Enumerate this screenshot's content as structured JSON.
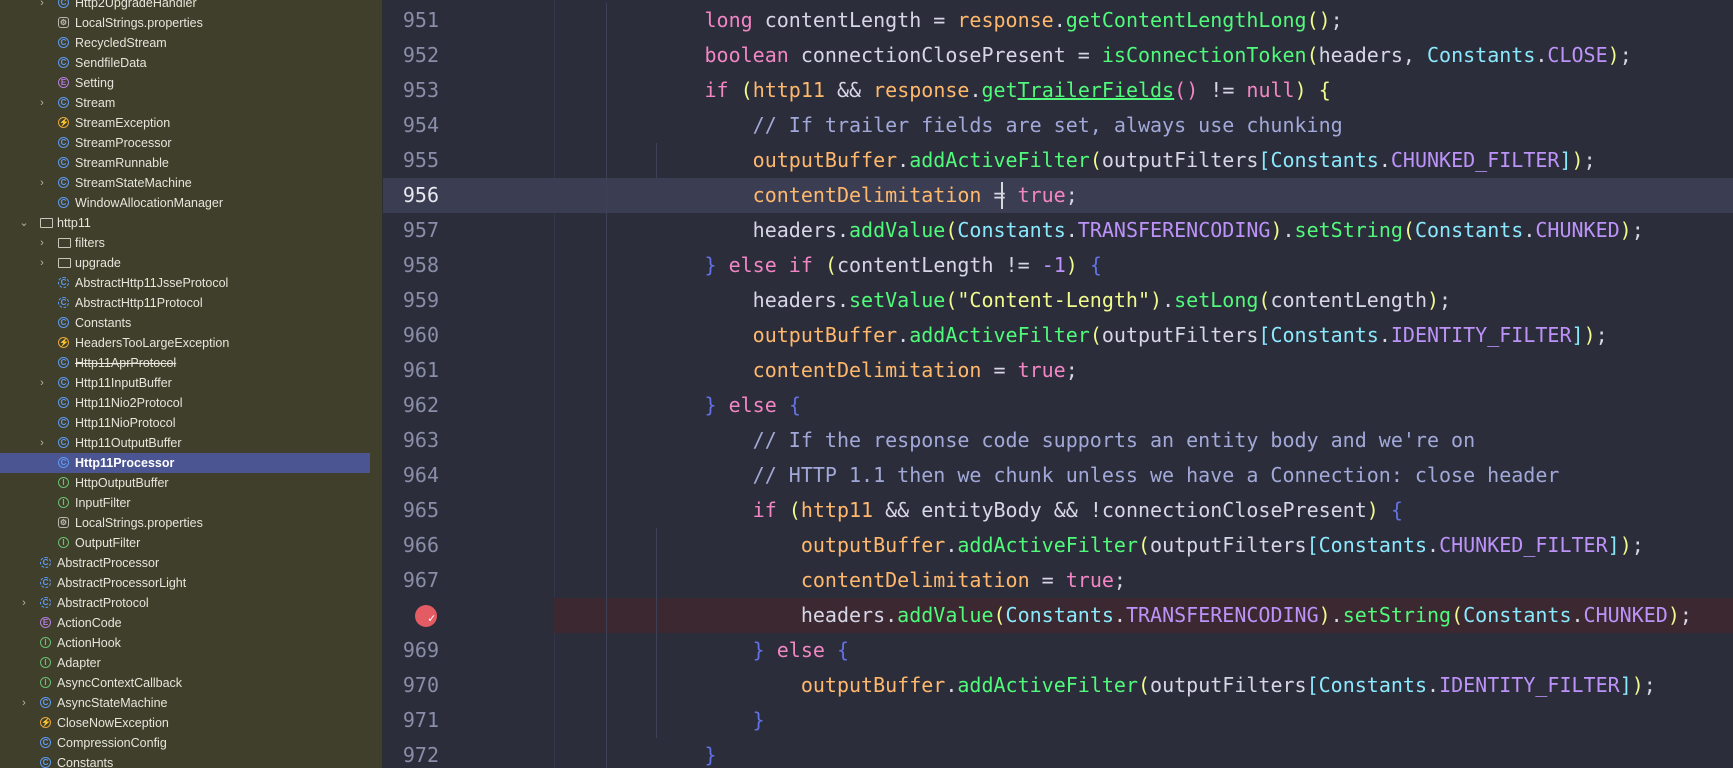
{
  "sidebar": {
    "items": [
      {
        "label": "Http2UpgradeHandler",
        "icon": "class",
        "chevron": true,
        "indent": 2
      },
      {
        "label": "LocalStrings.properties",
        "icon": "props",
        "chevron": false,
        "indent": 2
      },
      {
        "label": "RecycledStream",
        "icon": "class",
        "chevron": false,
        "indent": 2
      },
      {
        "label": "SendfileData",
        "icon": "class",
        "chevron": false,
        "indent": 2
      },
      {
        "label": "Setting",
        "icon": "enum",
        "chevron": false,
        "indent": 2
      },
      {
        "label": "Stream",
        "icon": "class",
        "chevron": true,
        "indent": 2
      },
      {
        "label": "StreamException",
        "icon": "exception",
        "chevron": false,
        "indent": 2
      },
      {
        "label": "StreamProcessor",
        "icon": "class",
        "chevron": false,
        "indent": 2
      },
      {
        "label": "StreamRunnable",
        "icon": "class",
        "chevron": false,
        "indent": 2
      },
      {
        "label": "StreamStateMachine",
        "icon": "class",
        "chevron": true,
        "indent": 2
      },
      {
        "label": "WindowAllocationManager",
        "icon": "class",
        "chevron": false,
        "indent": 2
      },
      {
        "label": "http11",
        "icon": "folder",
        "chevron": "open",
        "indent": 1
      },
      {
        "label": "filters",
        "icon": "folder",
        "chevron": true,
        "indent": 2
      },
      {
        "label": "upgrade",
        "icon": "folder",
        "chevron": true,
        "indent": 2
      },
      {
        "label": "AbstractHttp11JsseProtocol",
        "icon": "abstract",
        "chevron": false,
        "indent": 2
      },
      {
        "label": "AbstractHttp11Protocol",
        "icon": "abstract",
        "chevron": false,
        "indent": 2
      },
      {
        "label": "Constants",
        "icon": "class",
        "chevron": false,
        "indent": 2
      },
      {
        "label": "HeadersTooLargeException",
        "icon": "exception",
        "chevron": false,
        "indent": 2
      },
      {
        "label": "Http11AprProtocol",
        "icon": "class",
        "chevron": false,
        "indent": 2,
        "deprecated": true
      },
      {
        "label": "Http11InputBuffer",
        "icon": "class",
        "chevron": true,
        "indent": 2
      },
      {
        "label": "Http11Nio2Protocol",
        "icon": "class",
        "chevron": false,
        "indent": 2
      },
      {
        "label": "Http11NioProtocol",
        "icon": "class",
        "chevron": false,
        "indent": 2
      },
      {
        "label": "Http11OutputBuffer",
        "icon": "class",
        "chevron": true,
        "indent": 2
      },
      {
        "label": "Http11Processor",
        "icon": "class",
        "chevron": false,
        "indent": 2,
        "selected": true
      },
      {
        "label": "HttpOutputBuffer",
        "icon": "interface",
        "chevron": false,
        "indent": 2
      },
      {
        "label": "InputFilter",
        "icon": "interface",
        "chevron": false,
        "indent": 2
      },
      {
        "label": "LocalStrings.properties",
        "icon": "props",
        "chevron": false,
        "indent": 2
      },
      {
        "label": "OutputFilter",
        "icon": "interface",
        "chevron": false,
        "indent": 2
      },
      {
        "label": "AbstractProcessor",
        "icon": "abstract",
        "chevron": false,
        "indent": 1
      },
      {
        "label": "AbstractProcessorLight",
        "icon": "abstract",
        "chevron": false,
        "indent": 1
      },
      {
        "label": "AbstractProtocol",
        "icon": "abstract",
        "chevron": true,
        "indent": 1
      },
      {
        "label": "ActionCode",
        "icon": "enum",
        "chevron": false,
        "indent": 1
      },
      {
        "label": "ActionHook",
        "icon": "interface",
        "chevron": false,
        "indent": 1
      },
      {
        "label": "Adapter",
        "icon": "interface",
        "chevron": false,
        "indent": 1
      },
      {
        "label": "AsyncContextCallback",
        "icon": "interface",
        "chevron": false,
        "indent": 1
      },
      {
        "label": "AsyncStateMachine",
        "icon": "class",
        "chevron": true,
        "indent": 1
      },
      {
        "label": "CloseNowException",
        "icon": "exception",
        "chevron": false,
        "indent": 1
      },
      {
        "label": "CompressionConfig",
        "icon": "class",
        "chevron": false,
        "indent": 1
      },
      {
        "label": "Constants",
        "icon": "class",
        "chevron": false,
        "indent": 1
      }
    ]
  },
  "editor": {
    "lines": [
      {
        "num": "951",
        "tokens": [
          [
            "",
            "            "
          ],
          [
            "kw",
            "long"
          ],
          [
            "",
            " contentLength = "
          ],
          [
            "fld",
            "response"
          ],
          [
            "",
            "."
          ],
          [
            "fn",
            "getContentLengthLong"
          ],
          [
            "br1",
            "()"
          ],
          [
            "",
            ";"
          ]
        ]
      },
      {
        "num": "952",
        "tokens": [
          [
            "",
            "            "
          ],
          [
            "kw",
            "boolean"
          ],
          [
            "",
            " connectionClosePresent = "
          ],
          [
            "fn",
            "isConnectionToken"
          ],
          [
            "br1",
            "("
          ],
          [
            "",
            "headers, "
          ],
          [
            "typ",
            "Constants"
          ],
          [
            "",
            "."
          ],
          [
            "cst",
            "CLOSE"
          ],
          [
            "br1",
            ")"
          ],
          [
            "",
            ";"
          ]
        ]
      },
      {
        "num": "953",
        "tokens": [
          [
            "",
            "            "
          ],
          [
            "kw",
            "if"
          ],
          [
            "",
            " "
          ],
          [
            "br1",
            "("
          ],
          [
            "fld",
            "http11"
          ],
          [
            "",
            " && "
          ],
          [
            "fld",
            "response"
          ],
          [
            "",
            "."
          ],
          [
            "fn",
            "get"
          ],
          [
            "fn und",
            "TrailerFields"
          ],
          [
            "br2",
            "()"
          ],
          [
            "",
            " != "
          ],
          [
            "kw",
            "null"
          ],
          [
            "br1",
            ")"
          ],
          [
            "",
            " "
          ],
          [
            "br1",
            "{"
          ]
        ]
      },
      {
        "num": "954",
        "tokens": [
          [
            "",
            "                "
          ],
          [
            "cmt",
            "// If trailer fields are set, always use chunking"
          ]
        ]
      },
      {
        "num": "955",
        "tokens": [
          [
            "",
            "                "
          ],
          [
            "fld",
            "outputBuffer"
          ],
          [
            "",
            "."
          ],
          [
            "fn",
            "addActiveFilter"
          ],
          [
            "br1",
            "("
          ],
          [
            "",
            "outputFilters"
          ],
          [
            "br3",
            "["
          ],
          [
            "typ",
            "Constants"
          ],
          [
            "",
            "."
          ],
          [
            "cst",
            "CHUNKED_FILTER"
          ],
          [
            "br3",
            "]"
          ],
          [
            "br1",
            ")"
          ],
          [
            "",
            ";"
          ]
        ]
      },
      {
        "num": "956",
        "current": true,
        "tokens": [
          [
            "",
            "                "
          ],
          [
            "fld",
            "contentDelimitation"
          ],
          [
            "",
            " = "
          ],
          [
            "kw",
            "true"
          ],
          [
            "",
            ";"
          ]
        ]
      },
      {
        "num": "957",
        "tokens": [
          [
            "",
            "                headers."
          ],
          [
            "fn",
            "addValue"
          ],
          [
            "br1",
            "("
          ],
          [
            "typ",
            "Constants"
          ],
          [
            "",
            "."
          ],
          [
            "cst",
            "TRANSFERENCODING"
          ],
          [
            "br1",
            ")"
          ],
          [
            "",
            "."
          ],
          [
            "fn",
            "setString"
          ],
          [
            "br1",
            "("
          ],
          [
            "typ",
            "Constants"
          ],
          [
            "",
            "."
          ],
          [
            "cst",
            "CHUNKED"
          ],
          [
            "br1",
            ")"
          ],
          [
            "",
            ";"
          ]
        ]
      },
      {
        "num": "958",
        "tokens": [
          [
            "",
            "            "
          ],
          [
            "brb",
            "}"
          ],
          [
            "",
            " "
          ],
          [
            "kw",
            "else if"
          ],
          [
            "",
            " "
          ],
          [
            "br1",
            "("
          ],
          [
            "",
            "contentLength != "
          ],
          [
            "num",
            "-1"
          ],
          [
            "br1",
            ")"
          ],
          [
            "",
            " "
          ],
          [
            "brb",
            "{"
          ]
        ]
      },
      {
        "num": "959",
        "tokens": [
          [
            "",
            "                headers."
          ],
          [
            "fn",
            "setValue"
          ],
          [
            "br1",
            "("
          ],
          [
            "str",
            "\"Content-Length\""
          ],
          [
            "br1",
            ")"
          ],
          [
            "",
            "."
          ],
          [
            "fn",
            "setLong"
          ],
          [
            "br1",
            "("
          ],
          [
            "",
            "contentLength"
          ],
          [
            "br1",
            ")"
          ],
          [
            "",
            ";"
          ]
        ]
      },
      {
        "num": "960",
        "tokens": [
          [
            "",
            "                "
          ],
          [
            "fld",
            "outputBuffer"
          ],
          [
            "",
            "."
          ],
          [
            "fn",
            "addActiveFilter"
          ],
          [
            "br1",
            "("
          ],
          [
            "",
            "outputFilters"
          ],
          [
            "br3",
            "["
          ],
          [
            "typ",
            "Constants"
          ],
          [
            "",
            "."
          ],
          [
            "cst",
            "IDENTITY_FILTER"
          ],
          [
            "br3",
            "]"
          ],
          [
            "br1",
            ")"
          ],
          [
            "",
            ";"
          ]
        ]
      },
      {
        "num": "961",
        "tokens": [
          [
            "",
            "                "
          ],
          [
            "fld",
            "contentDelimitation"
          ],
          [
            "",
            " = "
          ],
          [
            "kw",
            "true"
          ],
          [
            "",
            ";"
          ]
        ]
      },
      {
        "num": "962",
        "tokens": [
          [
            "",
            "            "
          ],
          [
            "brb",
            "}"
          ],
          [
            "",
            " "
          ],
          [
            "kw",
            "else"
          ],
          [
            "",
            " "
          ],
          [
            "brb",
            "{"
          ]
        ]
      },
      {
        "num": "963",
        "tokens": [
          [
            "",
            "                "
          ],
          [
            "cmt",
            "// If the response code supports an entity body and we're on"
          ]
        ]
      },
      {
        "num": "964",
        "tokens": [
          [
            "",
            "                "
          ],
          [
            "cmt",
            "// HTTP 1.1 then we chunk unless we have a Connection: close header"
          ]
        ]
      },
      {
        "num": "965",
        "tokens": [
          [
            "",
            "                "
          ],
          [
            "kw",
            "if"
          ],
          [
            "",
            " "
          ],
          [
            "br1",
            "("
          ],
          [
            "fld",
            "http11"
          ],
          [
            "",
            " && entityBody && !connectionClosePresent"
          ],
          [
            "br1",
            ")"
          ],
          [
            "",
            " "
          ],
          [
            "brb",
            "{"
          ]
        ]
      },
      {
        "num": "966",
        "tokens": [
          [
            "",
            "                    "
          ],
          [
            "fld",
            "outputBuffer"
          ],
          [
            "",
            "."
          ],
          [
            "fn",
            "addActiveFilter"
          ],
          [
            "br1",
            "("
          ],
          [
            "",
            "outputFilters"
          ],
          [
            "br3",
            "["
          ],
          [
            "typ",
            "Constants"
          ],
          [
            "",
            "."
          ],
          [
            "cst",
            "CHUNKED_FILTER"
          ],
          [
            "br3",
            "]"
          ],
          [
            "br1",
            ")"
          ],
          [
            "",
            ";"
          ]
        ]
      },
      {
        "num": "967",
        "tokens": [
          [
            "",
            "                    "
          ],
          [
            "fld",
            "contentDelimitation"
          ],
          [
            "",
            " = "
          ],
          [
            "kw",
            "true"
          ],
          [
            "",
            ";"
          ]
        ]
      },
      {
        "num": "",
        "breakpoint": true,
        "tokens": [
          [
            "",
            "                    headers."
          ],
          [
            "fn",
            "addValue"
          ],
          [
            "br1",
            "("
          ],
          [
            "typ",
            "Constants"
          ],
          [
            "",
            "."
          ],
          [
            "cst",
            "TRANSFERENCODING"
          ],
          [
            "br1",
            ")"
          ],
          [
            "",
            "."
          ],
          [
            "fn",
            "setString"
          ],
          [
            "br1",
            "("
          ],
          [
            "typ",
            "Constants"
          ],
          [
            "",
            "."
          ],
          [
            "cst",
            "CHUNKED"
          ],
          [
            "br1",
            ")"
          ],
          [
            "",
            ";"
          ]
        ]
      },
      {
        "num": "969",
        "tokens": [
          [
            "",
            "                "
          ],
          [
            "brb",
            "}"
          ],
          [
            "",
            " "
          ],
          [
            "kw",
            "else"
          ],
          [
            "",
            " "
          ],
          [
            "brb",
            "{"
          ]
        ]
      },
      {
        "num": "970",
        "tokens": [
          [
            "",
            "                    "
          ],
          [
            "fld",
            "outputBuffer"
          ],
          [
            "",
            "."
          ],
          [
            "fn",
            "addActiveFilter"
          ],
          [
            "br1",
            "("
          ],
          [
            "",
            "outputFilters"
          ],
          [
            "br3",
            "["
          ],
          [
            "typ",
            "Constants"
          ],
          [
            "",
            "."
          ],
          [
            "cst",
            "IDENTITY_FILTER"
          ],
          [
            "br3",
            "]"
          ],
          [
            "br1",
            ")"
          ],
          [
            "",
            ";"
          ]
        ]
      },
      {
        "num": "971",
        "tokens": [
          [
            "",
            "                "
          ],
          [
            "brb",
            "}"
          ]
        ]
      },
      {
        "num": "972",
        "tokens": [
          [
            "",
            "            "
          ],
          [
            "brb",
            "}"
          ]
        ]
      }
    ]
  }
}
